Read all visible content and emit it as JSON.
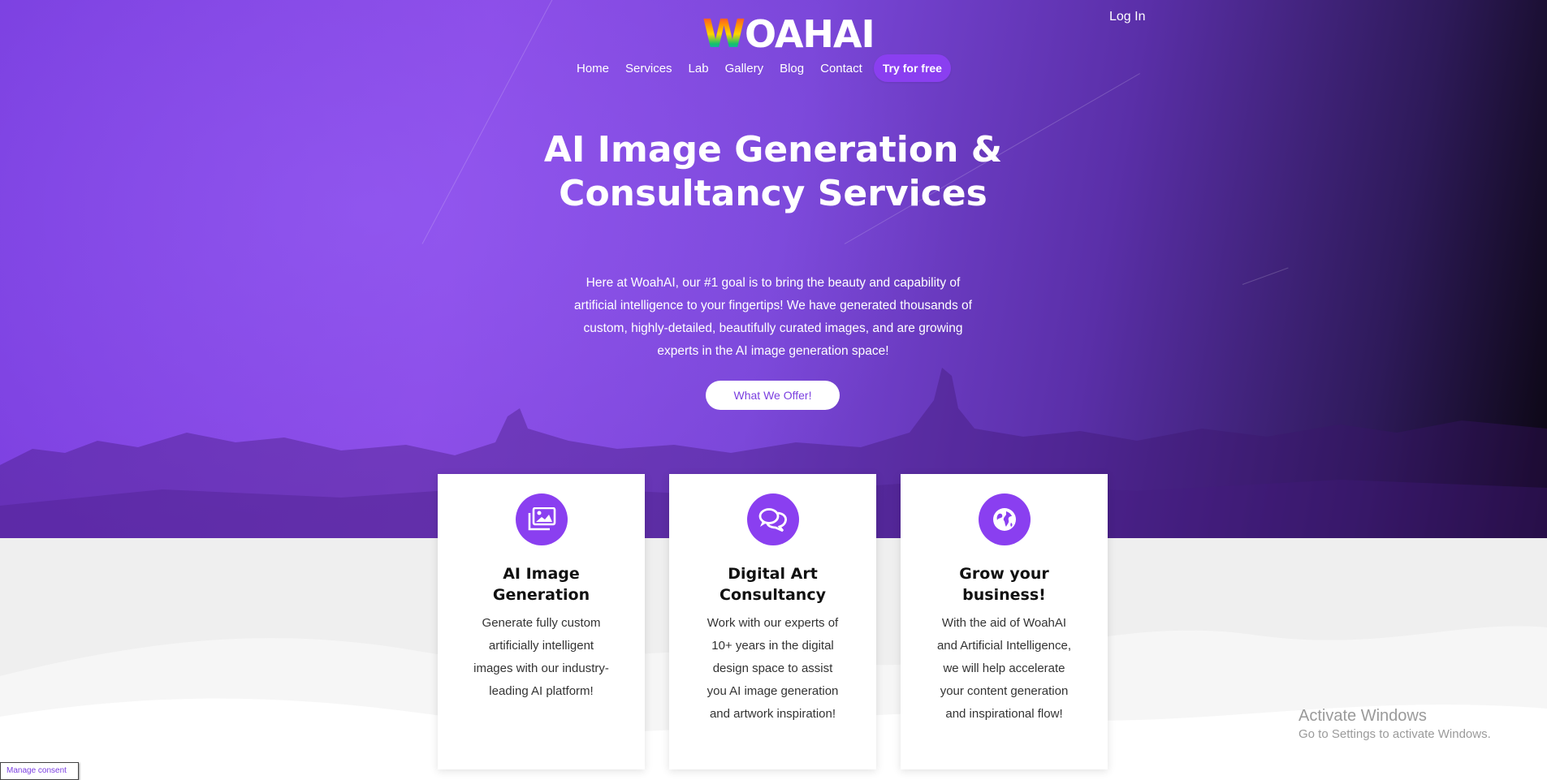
{
  "header": {
    "logo_text": "OAHAI",
    "logo_letter": "W",
    "login_label": "Log In"
  },
  "nav": {
    "items": [
      "Home",
      "Services",
      "Lab",
      "Gallery",
      "Blog",
      "Contact"
    ],
    "cta_label": "Try for free"
  },
  "hero": {
    "title": "AI Image Generation & Consultancy Services",
    "text": "Here at WoahAI, our #1 goal is to bring the beauty and capability of artificial intelligence to your fingertips! We have generated thousands of custom, highly-detailed, beautifully curated images, and are growing experts in the AI image generation space!",
    "button_label": "What We Offer!"
  },
  "cards": [
    {
      "icon": "images-icon",
      "title": "AI Image Generation",
      "text": "Generate fully custom artificially intelligent images with our industry-leading AI platform!"
    },
    {
      "icon": "chat-bubbles-icon",
      "title": "Digital Art Consultancy",
      "text": "Work with our experts of 10+ years in the digital design space to assist you AI image generation and artwork inspiration!"
    },
    {
      "icon": "globe-icon",
      "title": "Grow your business!",
      "text": "With the aid of WoahAI and Artificial Intelligence, we will help accelerate your content generation and inspirational flow!"
    }
  ],
  "watermark": {
    "title": "Activate Windows",
    "subtitle": "Go to Settings to activate Windows."
  },
  "consent": {
    "label": "Manage consent"
  },
  "colors": {
    "accent": "#8a3ff0",
    "hero_start": "#7b3fe0",
    "hero_end": "#0a0610"
  }
}
